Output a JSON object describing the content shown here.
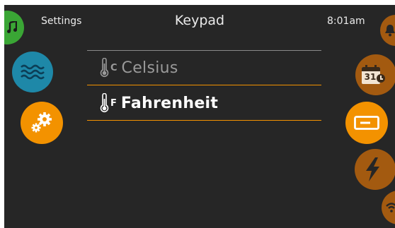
{
  "header": {
    "left_label": "Settings",
    "title": "Keypad",
    "time": "8:01am"
  },
  "options": [
    {
      "unit_letter": "C",
      "label": "Celsius",
      "selected": false
    },
    {
      "unit_letter": "F",
      "label": "Fahrenheit",
      "selected": true
    }
  ],
  "calendar": {
    "day": "31"
  },
  "icons": {
    "left": [
      "music-icon",
      "water-waves-icon",
      "gears-icon"
    ],
    "right": [
      "bell-icon",
      "calendar-clock-icon",
      "keypad-display-icon",
      "lightning-icon",
      "wifi-icon"
    ]
  },
  "colors": {
    "accent": "#f39200",
    "accent_dim": "#a35a10",
    "teal": "#1e88a8",
    "green": "#3aa635",
    "background": "#262626",
    "unselected_text": "#9a9a9a",
    "selected_text": "#ffffff"
  }
}
